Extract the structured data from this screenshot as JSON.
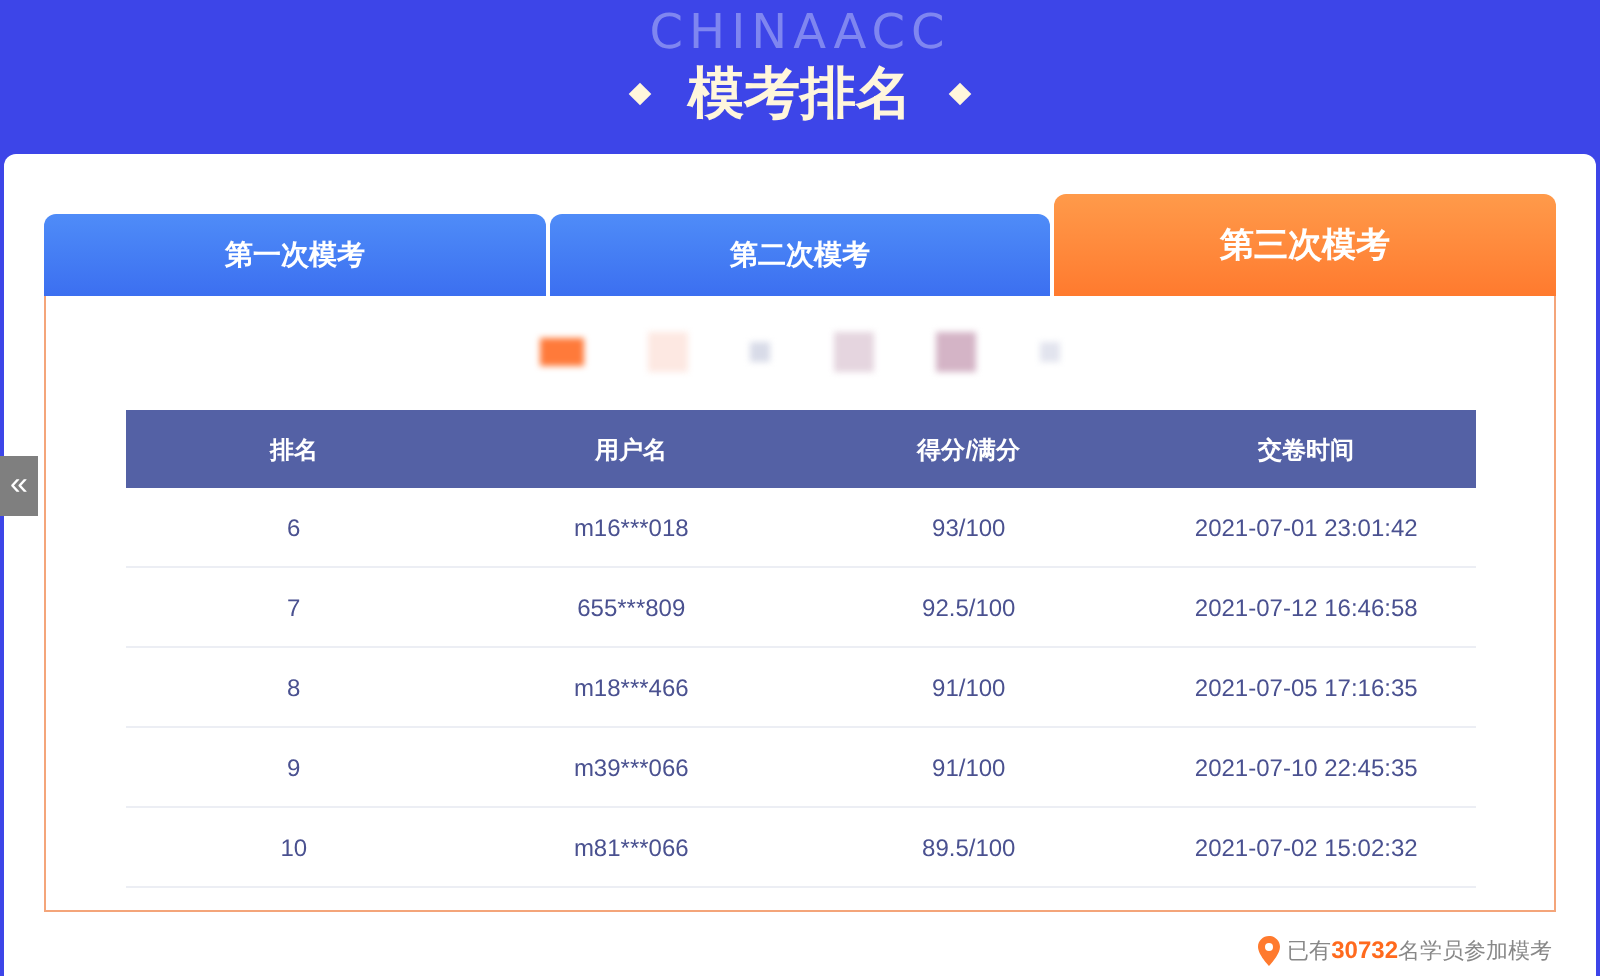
{
  "header": {
    "background_text": "CHINAACC",
    "title": "模考排名"
  },
  "tabs": [
    {
      "label": "第一次模考",
      "selected": false
    },
    {
      "label": "第二次模考",
      "selected": false
    },
    {
      "label": "第三次模考",
      "selected": true
    }
  ],
  "table": {
    "columns": [
      "排名",
      "用户名",
      "得分/满分",
      "交卷时间"
    ],
    "rows": [
      [
        "6",
        "m16***018",
        "93/100",
        "2021-07-01 23:01:42"
      ],
      [
        "7",
        "655***809",
        "92.5/100",
        "2021-07-12 16:46:58"
      ],
      [
        "8",
        "m18***466",
        "91/100",
        "2021-07-05 17:16:35"
      ],
      [
        "9",
        "m39***066",
        "91/100",
        "2021-07-10 22:45:35"
      ],
      [
        "10",
        "m81***066",
        "89.5/100",
        "2021-07-02 15:02:32"
      ]
    ]
  },
  "side_button": {
    "label": "«"
  },
  "footer": {
    "prefix": "已有",
    "count": "30732",
    "suffix": "名学员参加模考"
  }
}
